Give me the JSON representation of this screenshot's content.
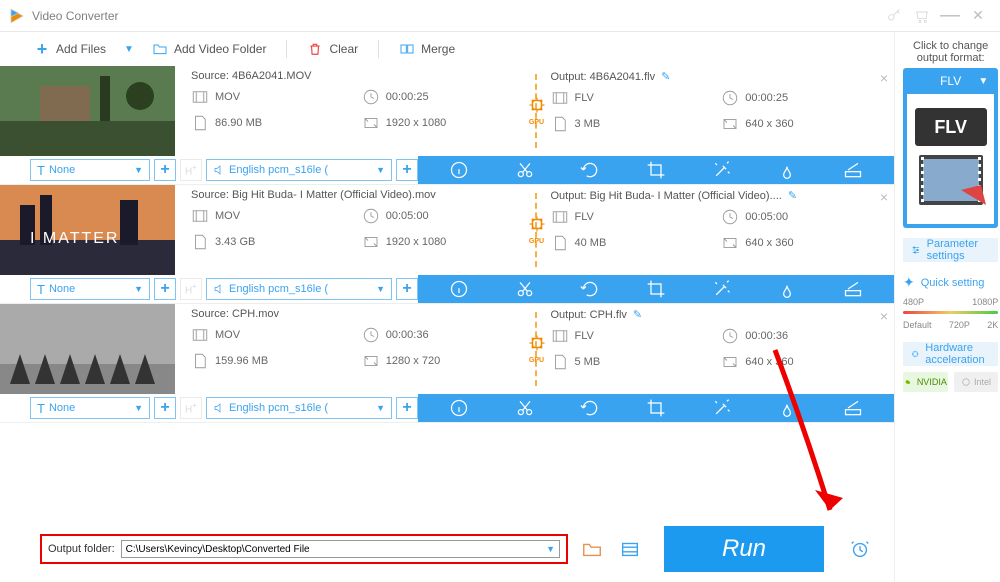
{
  "titlebar": {
    "title": "Video Converter"
  },
  "toolbar": {
    "add_files": "Add Files",
    "add_folder": "Add Video Folder",
    "clear": "Clear",
    "merge": "Merge"
  },
  "items": [
    {
      "source_label": "Source: 4B6A2041.MOV",
      "output_label": "Output: 4B6A2041.flv",
      "src": {
        "format": "MOV",
        "duration": "00:00:25",
        "size": "86.90 MB",
        "resolution": "1920 x 1080"
      },
      "out": {
        "format": "FLV",
        "duration": "00:00:25",
        "size": "3 MB",
        "resolution": "640 x 360"
      },
      "subtitle_sel": "None",
      "audio_sel": "English pcm_s16le (",
      "gpu_label": "GPU",
      "thumb_desc": "outdoor house garden"
    },
    {
      "source_label": "Source: Big Hit Buda- I Matter (Official Video).mov",
      "output_label": "Output: Big Hit Buda- I Matter (Official Video)....",
      "src": {
        "format": "MOV",
        "duration": "00:05:00",
        "size": "3.43 GB",
        "resolution": "1920 x 1080"
      },
      "out": {
        "format": "FLV",
        "duration": "00:05:00",
        "size": "40 MB",
        "resolution": "640 x 360"
      },
      "subtitle_sel": "None",
      "audio_sel": "English pcm_s16le (",
      "gpu_label": "GPU",
      "thumb_desc": "I MATTER sunset cityscape"
    },
    {
      "source_label": "Source: CPH.mov",
      "output_label": "Output: CPH.flv",
      "src": {
        "format": "MOV",
        "duration": "00:00:36",
        "size": "159.96 MB",
        "resolution": "1280 x 720"
      },
      "out": {
        "format": "FLV",
        "duration": "00:00:36",
        "size": "5 MB",
        "resolution": "640 x 360"
      },
      "subtitle_sel": "None",
      "audio_sel": "English pcm_s16le (",
      "gpu_label": "GPU",
      "thumb_desc": "legs walking in line"
    }
  ],
  "bottom": {
    "output_folder_label": "Output folder:",
    "output_folder_path": "C:\\Users\\Kevincy\\Desktop\\Converted File",
    "run": "Run"
  },
  "sidebar": {
    "header": "Click to change output format:",
    "format": "FLV",
    "badge": "FLV",
    "param": "Parameter settings",
    "quick": "Quick setting",
    "ticks_top": [
      "480P",
      "1080P"
    ],
    "ticks_bot": [
      "Default",
      "720P",
      "2K"
    ],
    "hw": "Hardware acceleration",
    "nvidia": "NVIDIA",
    "intel": "Intel"
  }
}
